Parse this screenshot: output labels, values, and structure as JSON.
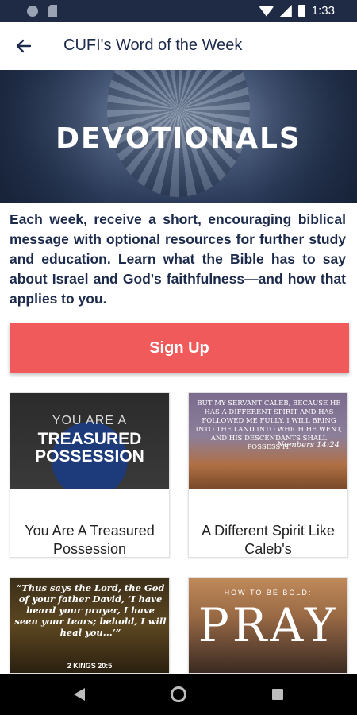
{
  "status_bar": {
    "time": "1:33"
  },
  "app_bar": {
    "title": "CUFI's Word of the Week",
    "back_icon": "arrow-left-icon"
  },
  "hero": {
    "heading": "DEVOTIONALS"
  },
  "description": "Each week, receive a short, encouraging biblical message with optional resources for further study and education. Learn what the Bible has to say about Israel and God's faithfulness—and how that applies to you.",
  "signup": {
    "label": "Sign Up",
    "color": "#f05a5a"
  },
  "cards": [
    {
      "caption": "You Are A Treasured Possession",
      "thumb_lines": [
        "YOU ARE A",
        "TREASURED",
        "POSSESSION"
      ]
    },
    {
      "caption": "A Different Spirit Like Caleb's",
      "thumb_text": "BUT MY SERVANT CALEB, BECAUSE HE HAS A DIFFERENT SPIRIT AND HAS FOLLOWED ME FULLY, I WILL BRING INTO THE LAND INTO WHICH HE WENT, AND HIS DESCENDANTS SHALL POSSESS IT.",
      "thumb_ref": "Numbers 14:24"
    },
    {
      "thumb_text": "“Thus says the Lord, the God of your father David, ‘I have heard your prayer, I have seen your tears; behold, I will heal you...’”",
      "thumb_ref": "2 KINGS 20:5"
    },
    {
      "thumb_small": "HOW TO BE BOLD:",
      "thumb_big": "PRAY"
    }
  ],
  "colors": {
    "status_bar": "#1f2a44",
    "title_text": "#1c2a4b"
  }
}
